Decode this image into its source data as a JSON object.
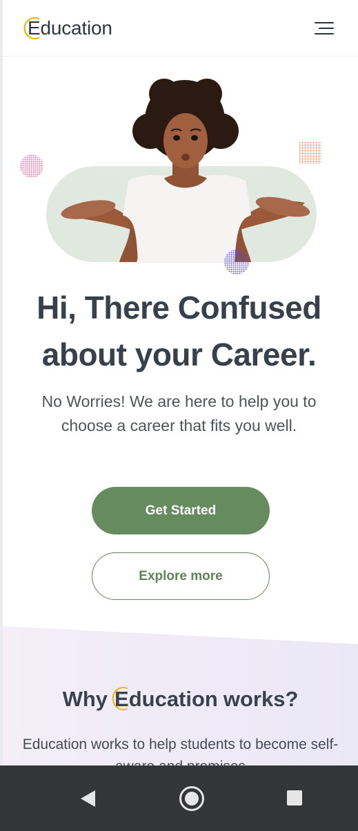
{
  "header": {
    "logo_text": "Education",
    "menu_icon": "hamburger-menu-icon"
  },
  "hero": {
    "illustration": "confused-woman-shrugging",
    "headline": "Hi, There Confused about your Career.",
    "subtext": "No Worries! We are here to help you to choose a career that fits you well."
  },
  "actions": {
    "primary_label": "Get Started",
    "secondary_label": "Explore more"
  },
  "why_section": {
    "title_prefix": "Why",
    "title_brand": "Education",
    "title_suffix": "works?",
    "body": "Education works to help students to become self-aware and promises"
  },
  "navbar": {
    "back_icon": "back-triangle-icon",
    "home_icon": "home-circle-icon",
    "recents_icon": "recents-square-icon"
  },
  "colors": {
    "accent_green": "#668b5e",
    "logo_yellow": "#f2b400",
    "pill_bg": "#e1e8df",
    "section_bg": "#efebf7",
    "navbar_bg": "#343537"
  }
}
